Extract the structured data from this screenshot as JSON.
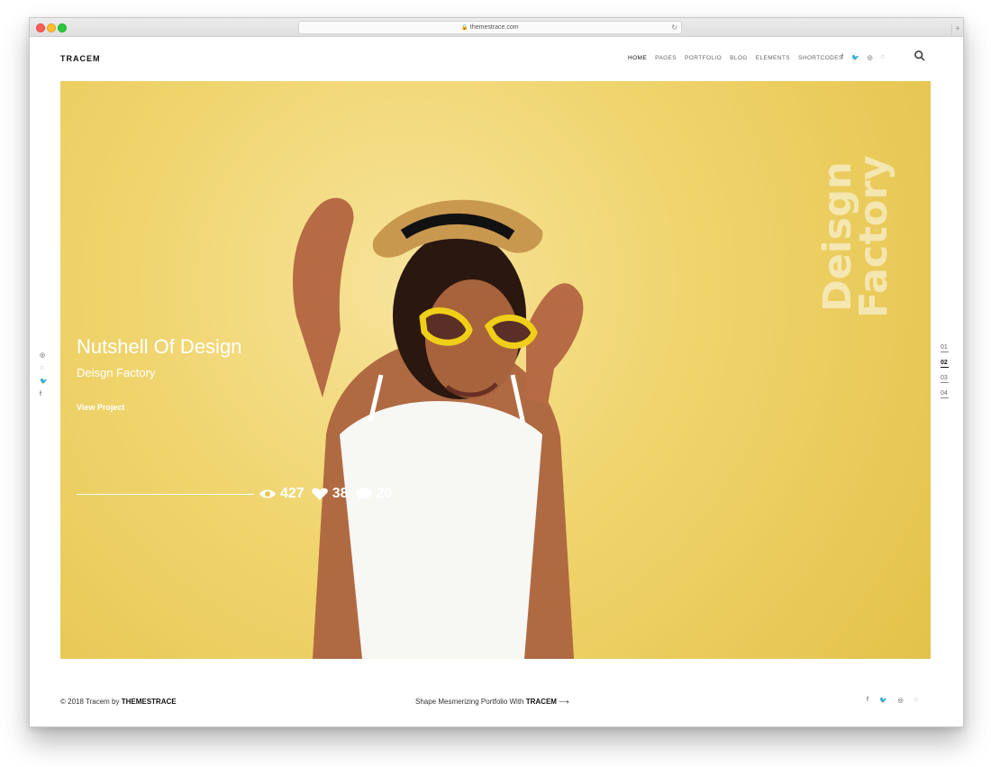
{
  "browser": {
    "url": "themestrace.com",
    "lock_icon": "🔒",
    "reload_icon": "↻",
    "new_tab": "+"
  },
  "header": {
    "logo": "TRACEM",
    "nav": [
      "HOME",
      "PAGES",
      "PORTFOLIO",
      "BLOG",
      "ELEMENTS",
      "SHORTCODES"
    ],
    "social": [
      "f",
      "🐦",
      "◎",
      "◌"
    ]
  },
  "hero": {
    "vertical_text": "Deisgn Factory",
    "title": "Nutshell Of Design",
    "subtitle": "Deisgn Factory",
    "cta": "View Project",
    "stats": {
      "views": "427",
      "likes": "38",
      "comments": "20"
    },
    "pagination": [
      "01",
      "02",
      "03",
      "04"
    ]
  },
  "left_social": [
    "◎",
    "◌",
    "🐦",
    "f"
  ],
  "footer": {
    "copyright_text": "© 2018 Tracem by ",
    "copyright_brand": "THEMESTRACE",
    "tagline_text": "Shape Mesmerizing Portfolio With ",
    "tagline_brand": "TRACEM",
    "arrow": "⟶",
    "social": [
      "f",
      "🐦",
      "◎",
      "◌"
    ]
  },
  "colors": {
    "hero_bg": "#f0d56f",
    "text_dark": "#111111",
    "text_white": "#ffffff"
  }
}
